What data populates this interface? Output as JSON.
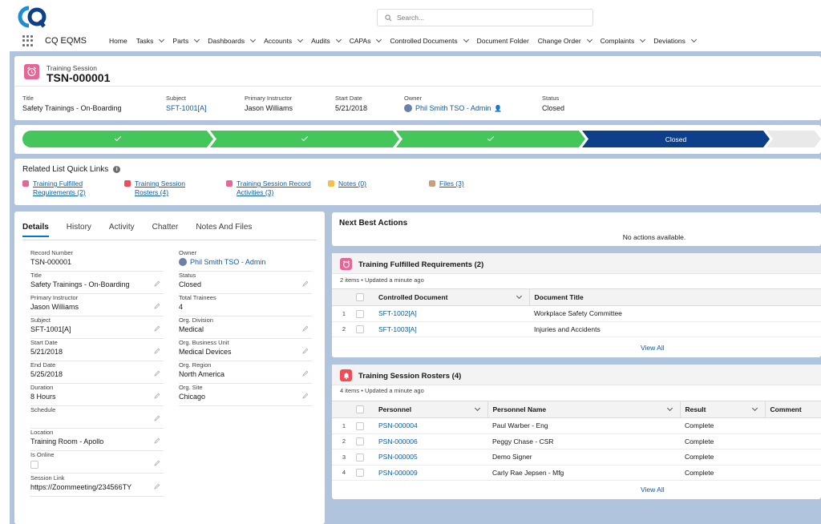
{
  "app": {
    "name": "CQ EQMS",
    "search_placeholder": "Search...",
    "nav": [
      {
        "label": "Home",
        "chevron": false
      },
      {
        "label": "Tasks",
        "chevron": true
      },
      {
        "label": "Parts",
        "chevron": true
      },
      {
        "label": "Dashboards",
        "chevron": true
      },
      {
        "label": "Accounts",
        "chevron": true
      },
      {
        "label": "Audits",
        "chevron": true
      },
      {
        "label": "CAPAs",
        "chevron": true
      },
      {
        "label": "Controlled Documents",
        "chevron": true
      },
      {
        "label": "Document Folder",
        "chevron": false
      },
      {
        "label": "Change Order",
        "chevron": true
      },
      {
        "label": "Complaints",
        "chevron": true
      },
      {
        "label": "Deviations",
        "chevron": true
      }
    ]
  },
  "record": {
    "type": "Training Session",
    "name": "TSN-000001",
    "highlights": {
      "title": {
        "label": "Title",
        "value": "Safety Trainings - On-Boarding"
      },
      "subject": {
        "label": "Subject",
        "value": "SFT-1001[A]"
      },
      "instructor": {
        "label": "Primary Instructor",
        "value": "Jason Williams"
      },
      "start_date": {
        "label": "Start Date",
        "value": "5/21/2018"
      },
      "owner": {
        "label": "Owner",
        "value": "Phil Smith TSO - Admin"
      },
      "status": {
        "label": "Status",
        "value": "Closed"
      }
    }
  },
  "path": {
    "current_label": "Closed",
    "completed_steps": 3,
    "colors": {
      "complete": "#45c65a",
      "current": "#0d3f8a",
      "future": "#e9e9e9"
    }
  },
  "quick_links": {
    "title": "Related List Quick Links",
    "items": [
      {
        "label1": "Training Fulfilled",
        "label2": "Requirements (2)",
        "color": "#e56798"
      },
      {
        "label1": "Training Session",
        "label2": "Rosters (4)",
        "color": "#ef4b58"
      },
      {
        "label1": "Training Session Record",
        "label2": "Activities (3)",
        "color": "#e56798"
      },
      {
        "label1": "Notes (0)",
        "label2": "",
        "color": "#f4c04d"
      },
      {
        "label1": "Files (3)",
        "label2": "",
        "color": "#c3a27d"
      }
    ]
  },
  "details": {
    "tabs": [
      "Details",
      "History",
      "Activity",
      "Chatter",
      "Notes And Files"
    ],
    "left_fields": [
      {
        "label": "Record Number",
        "value": "TSN-000001",
        "link": false
      },
      {
        "label": "Title",
        "value": "Safety Trainings - On-Boarding",
        "link": false
      },
      {
        "label": "Primary Instructor",
        "value": "Jason Williams",
        "link": false
      },
      {
        "label": "Subject",
        "value": "SFT-1001[A]",
        "link": true
      },
      {
        "label": "Start Date",
        "value": "5/21/2018",
        "link": false
      },
      {
        "label": "End Date",
        "value": "5/25/2018",
        "link": false
      },
      {
        "label": "Duration",
        "value": "8 Hours",
        "link": false
      },
      {
        "label": "Schedule",
        "value": "",
        "link": false
      },
      {
        "label": "Location",
        "value": "Training Room - Apollo",
        "link": false
      },
      {
        "label": "Is Online",
        "value": "",
        "link": false
      },
      {
        "label": "Session Link",
        "value": "https://Zoommeeting/234566TY",
        "link": true
      }
    ],
    "right_fields": [
      {
        "label": "Owner",
        "value": "Phil Smith TSO - Admin",
        "link": true
      },
      {
        "label": "Status",
        "value": "Closed",
        "link": false
      },
      {
        "label": "Total Trainees",
        "value": "4",
        "link": false
      },
      {
        "label": "Org. Division",
        "value": "Medical",
        "link": false
      },
      {
        "label": "Org. Business Unit",
        "value": "Medical Devices",
        "link": false
      },
      {
        "label": "Org. Region",
        "value": "North America",
        "link": false
      },
      {
        "label": "Org. Site",
        "value": "Chicago",
        "link": false
      }
    ]
  },
  "next_best_actions": {
    "title": "Next Best Actions",
    "empty": "No actions available."
  },
  "fulfilled_requirements": {
    "title": "Training Fulfilled Requirements (2)",
    "subtitle": "2 items • Updated a minute ago",
    "columns": [
      "Controlled Document",
      "Document Title"
    ],
    "rows": [
      {
        "num": "1",
        "doc": "SFT-1002[A]",
        "title": "Workplace Safety Committee"
      },
      {
        "num": "2",
        "doc": "SFT-1003[A]",
        "title": "Injuries and Accidents"
      }
    ],
    "view_all": "View All"
  },
  "rosters": {
    "title": "Training Session Rosters (4)",
    "subtitle": "4 items • Updated a minute ago",
    "columns": [
      "Personnel",
      "Personnel Name",
      "Result",
      "Comment"
    ],
    "rows": [
      {
        "num": "1",
        "personnel": "PSN-000004",
        "name": "Paul Warber - Eng",
        "result": "Complete"
      },
      {
        "num": "2",
        "personnel": "PSN-000006",
        "name": "Peggy Chase - CSR",
        "result": "Complete"
      },
      {
        "num": "3",
        "personnel": "PSN-000005",
        "name": "Demo Signer",
        "result": "Complete"
      },
      {
        "num": "4",
        "personnel": "PSN-000009",
        "name": "Carly Rae Jepsen - Mfg",
        "result": "Complete"
      }
    ],
    "view_all": "View All"
  }
}
